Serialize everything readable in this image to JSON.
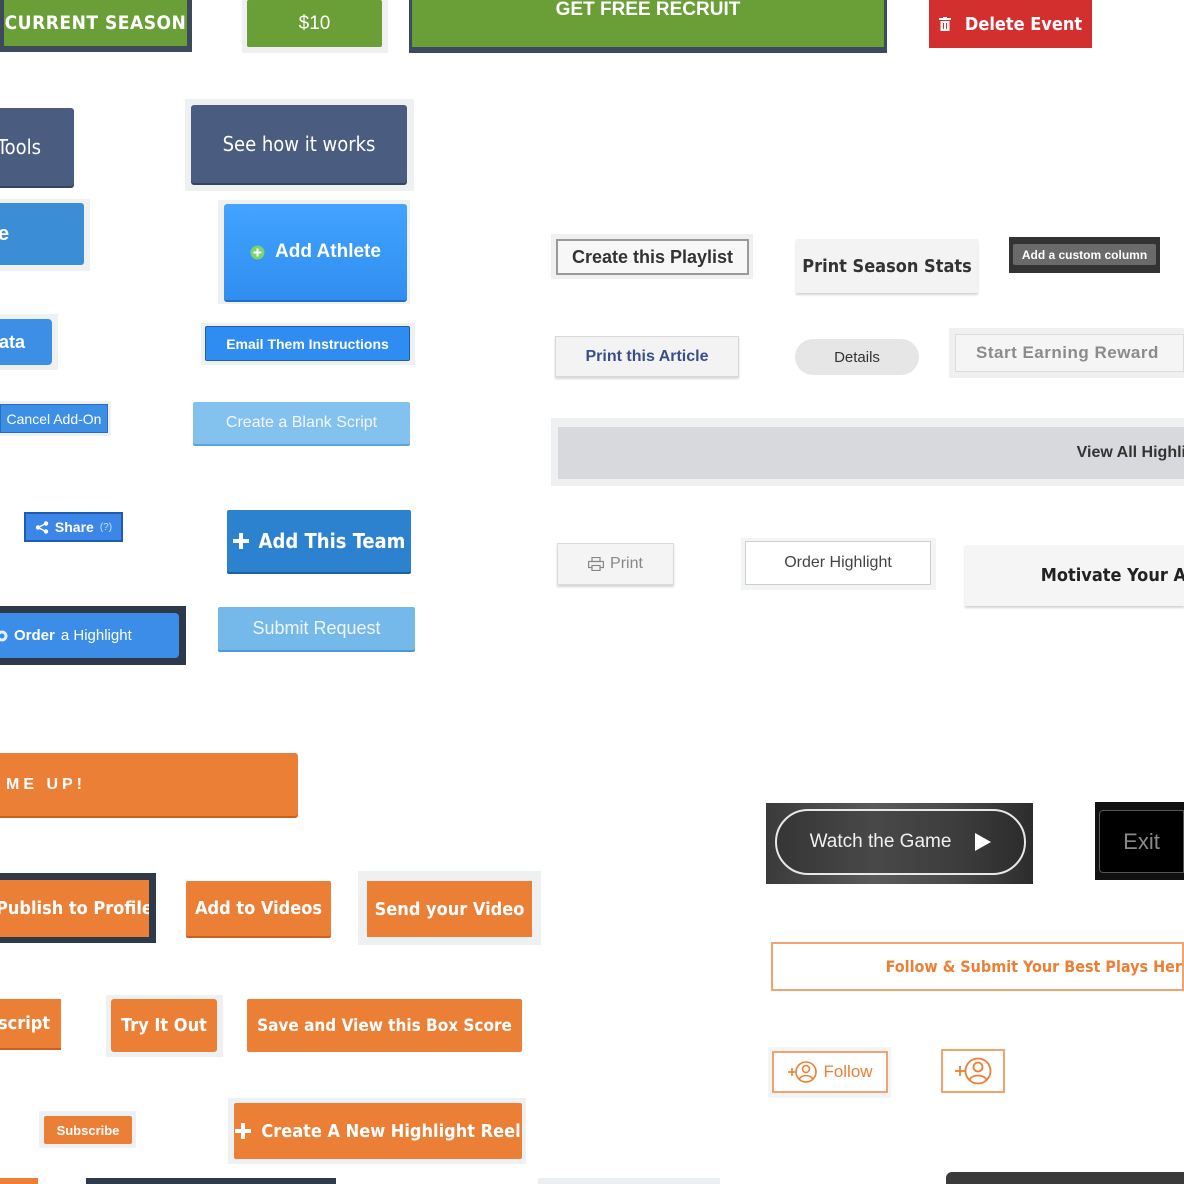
{
  "buttons": {
    "current_season": "CURRENT SEASON",
    "price": "$10",
    "get_free_recruit": "GET FREE RECRUIT",
    "delete_event": "Delete Event",
    "tools": "Tools",
    "see_how": "See how it works",
    "partial_e": "e",
    "add_athlete": "Add Athlete",
    "partial_ata": "ata",
    "email_instructions": "Email Them Instructions",
    "cancel_addon": "Cancel Add-On",
    "blank_script": "Create a Blank Script",
    "share": "Share",
    "share_help": "(?)",
    "add_team": "Add This Team",
    "order_a": "Order",
    "order_b": "a Highlight",
    "submit_request": "Submit Request",
    "me_up": "ME UP!",
    "publish_profile": "Publish to Profile",
    "add_videos": "Add to Videos",
    "send_video": "Send your Video",
    "script": "script",
    "try_out": "Try It Out",
    "save_box_score": "Save and View this Box Score",
    "subscribe": "Subscribe",
    "create_reel": "Create A New Highlight Reel",
    "create_playlist": "Create this Playlist",
    "print_stats": "Print Season Stats",
    "custom_column": "Add a custom column",
    "print_article": "Print this Article",
    "details": "Details",
    "start_earning": "Start Earning Reward",
    "view_all": "View All Highli",
    "print": "Print",
    "order_highlight": "Order Highlight",
    "motivate": "Motivate Your A",
    "watch_game": "Watch the Game",
    "exit": "Exit",
    "follow_submit": "Follow & Submit Your Best Plays Her",
    "follow": "Follow"
  },
  "icons": {
    "delete": "trash-icon",
    "add_athlete": "plus-circle-icon",
    "share": "share-icon",
    "add_team": "plus-icon",
    "order": "camera-icon",
    "create_reel": "plus-icon",
    "print": "printer-icon",
    "watch_game": "play-icon",
    "follow": "add-user-icon"
  },
  "colors": {
    "green": "#6a9e36",
    "red": "#d32f2f",
    "slate": "#4a5d80",
    "blue": "#3d8fd9",
    "orange": "#ec7f36",
    "dark": "#2e3a4a"
  }
}
